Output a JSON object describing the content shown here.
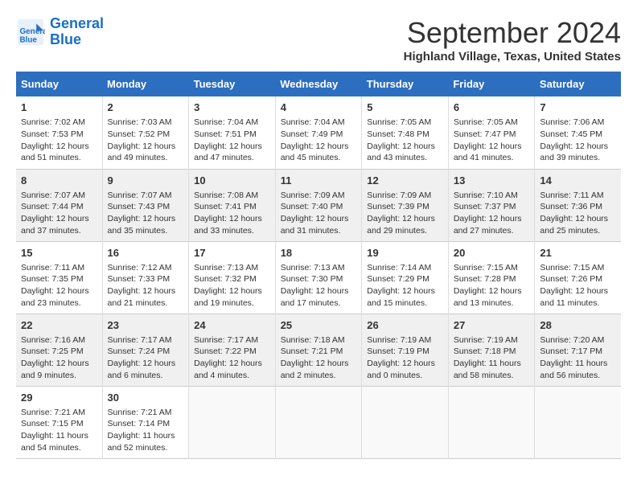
{
  "header": {
    "logo_line1": "General",
    "logo_line2": "Blue",
    "month": "September 2024",
    "location": "Highland Village, Texas, United States"
  },
  "days_of_week": [
    "Sunday",
    "Monday",
    "Tuesday",
    "Wednesday",
    "Thursday",
    "Friday",
    "Saturday"
  ],
  "weeks": [
    [
      {
        "day": 1,
        "lines": [
          "Sunrise: 7:02 AM",
          "Sunset: 7:53 PM",
          "Daylight: 12 hours",
          "and 51 minutes."
        ]
      },
      {
        "day": 2,
        "lines": [
          "Sunrise: 7:03 AM",
          "Sunset: 7:52 PM",
          "Daylight: 12 hours",
          "and 49 minutes."
        ]
      },
      {
        "day": 3,
        "lines": [
          "Sunrise: 7:04 AM",
          "Sunset: 7:51 PM",
          "Daylight: 12 hours",
          "and 47 minutes."
        ]
      },
      {
        "day": 4,
        "lines": [
          "Sunrise: 7:04 AM",
          "Sunset: 7:49 PM",
          "Daylight: 12 hours",
          "and 45 minutes."
        ]
      },
      {
        "day": 5,
        "lines": [
          "Sunrise: 7:05 AM",
          "Sunset: 7:48 PM",
          "Daylight: 12 hours",
          "and 43 minutes."
        ]
      },
      {
        "day": 6,
        "lines": [
          "Sunrise: 7:05 AM",
          "Sunset: 7:47 PM",
          "Daylight: 12 hours",
          "and 41 minutes."
        ]
      },
      {
        "day": 7,
        "lines": [
          "Sunrise: 7:06 AM",
          "Sunset: 7:45 PM",
          "Daylight: 12 hours",
          "and 39 minutes."
        ]
      }
    ],
    [
      {
        "day": 8,
        "lines": [
          "Sunrise: 7:07 AM",
          "Sunset: 7:44 PM",
          "Daylight: 12 hours",
          "and 37 minutes."
        ]
      },
      {
        "day": 9,
        "lines": [
          "Sunrise: 7:07 AM",
          "Sunset: 7:43 PM",
          "Daylight: 12 hours",
          "and 35 minutes."
        ]
      },
      {
        "day": 10,
        "lines": [
          "Sunrise: 7:08 AM",
          "Sunset: 7:41 PM",
          "Daylight: 12 hours",
          "and 33 minutes."
        ]
      },
      {
        "day": 11,
        "lines": [
          "Sunrise: 7:09 AM",
          "Sunset: 7:40 PM",
          "Daylight: 12 hours",
          "and 31 minutes."
        ]
      },
      {
        "day": 12,
        "lines": [
          "Sunrise: 7:09 AM",
          "Sunset: 7:39 PM",
          "Daylight: 12 hours",
          "and 29 minutes."
        ]
      },
      {
        "day": 13,
        "lines": [
          "Sunrise: 7:10 AM",
          "Sunset: 7:37 PM",
          "Daylight: 12 hours",
          "and 27 minutes."
        ]
      },
      {
        "day": 14,
        "lines": [
          "Sunrise: 7:11 AM",
          "Sunset: 7:36 PM",
          "Daylight: 12 hours",
          "and 25 minutes."
        ]
      }
    ],
    [
      {
        "day": 15,
        "lines": [
          "Sunrise: 7:11 AM",
          "Sunset: 7:35 PM",
          "Daylight: 12 hours",
          "and 23 minutes."
        ]
      },
      {
        "day": 16,
        "lines": [
          "Sunrise: 7:12 AM",
          "Sunset: 7:33 PM",
          "Daylight: 12 hours",
          "and 21 minutes."
        ]
      },
      {
        "day": 17,
        "lines": [
          "Sunrise: 7:13 AM",
          "Sunset: 7:32 PM",
          "Daylight: 12 hours",
          "and 19 minutes."
        ]
      },
      {
        "day": 18,
        "lines": [
          "Sunrise: 7:13 AM",
          "Sunset: 7:30 PM",
          "Daylight: 12 hours",
          "and 17 minutes."
        ]
      },
      {
        "day": 19,
        "lines": [
          "Sunrise: 7:14 AM",
          "Sunset: 7:29 PM",
          "Daylight: 12 hours",
          "and 15 minutes."
        ]
      },
      {
        "day": 20,
        "lines": [
          "Sunrise: 7:15 AM",
          "Sunset: 7:28 PM",
          "Daylight: 12 hours",
          "and 13 minutes."
        ]
      },
      {
        "day": 21,
        "lines": [
          "Sunrise: 7:15 AM",
          "Sunset: 7:26 PM",
          "Daylight: 12 hours",
          "and 11 minutes."
        ]
      }
    ],
    [
      {
        "day": 22,
        "lines": [
          "Sunrise: 7:16 AM",
          "Sunset: 7:25 PM",
          "Daylight: 12 hours",
          "and 9 minutes."
        ]
      },
      {
        "day": 23,
        "lines": [
          "Sunrise: 7:17 AM",
          "Sunset: 7:24 PM",
          "Daylight: 12 hours",
          "and 6 minutes."
        ]
      },
      {
        "day": 24,
        "lines": [
          "Sunrise: 7:17 AM",
          "Sunset: 7:22 PM",
          "Daylight: 12 hours",
          "and 4 minutes."
        ]
      },
      {
        "day": 25,
        "lines": [
          "Sunrise: 7:18 AM",
          "Sunset: 7:21 PM",
          "Daylight: 12 hours",
          "and 2 minutes."
        ]
      },
      {
        "day": 26,
        "lines": [
          "Sunrise: 7:19 AM",
          "Sunset: 7:19 PM",
          "Daylight: 12 hours",
          "and 0 minutes."
        ]
      },
      {
        "day": 27,
        "lines": [
          "Sunrise: 7:19 AM",
          "Sunset: 7:18 PM",
          "Daylight: 11 hours",
          "and 58 minutes."
        ]
      },
      {
        "day": 28,
        "lines": [
          "Sunrise: 7:20 AM",
          "Sunset: 7:17 PM",
          "Daylight: 11 hours",
          "and 56 minutes."
        ]
      }
    ],
    [
      {
        "day": 29,
        "lines": [
          "Sunrise: 7:21 AM",
          "Sunset: 7:15 PM",
          "Daylight: 11 hours",
          "and 54 minutes."
        ]
      },
      {
        "day": 30,
        "lines": [
          "Sunrise: 7:21 AM",
          "Sunset: 7:14 PM",
          "Daylight: 11 hours",
          "and 52 minutes."
        ]
      },
      null,
      null,
      null,
      null,
      null
    ]
  ]
}
